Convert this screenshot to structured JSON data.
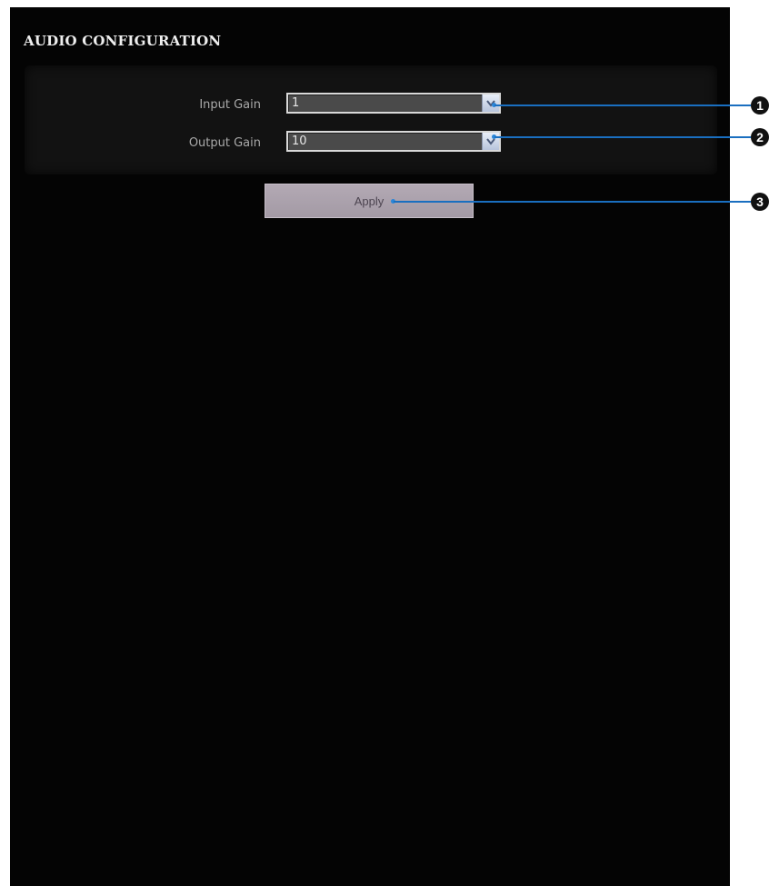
{
  "page": {
    "title": "AUDIO CONFIGURATION"
  },
  "settings": {
    "input_gain": {
      "label": "Input Gain",
      "value": "1"
    },
    "output_gain": {
      "label": "Output Gain",
      "value": "10"
    }
  },
  "actions": {
    "apply_label": "Apply"
  },
  "callouts": [
    "1",
    "2",
    "3"
  ],
  "icons": {
    "dropdown": "chevron-down-icon"
  },
  "colors": {
    "background": "#040404",
    "settings_box": "#121212",
    "select_bg": "#4a4a4a",
    "button_bg": "#aaa0ab",
    "callout": "#1a6fc0"
  }
}
